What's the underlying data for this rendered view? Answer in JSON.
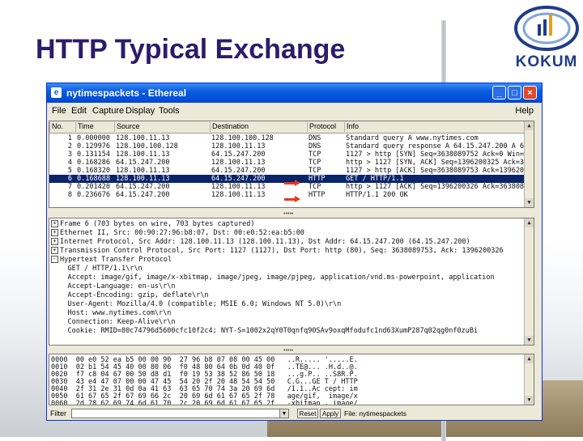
{
  "slide": {
    "title": "HTTP Typical Exchange",
    "logo_text": "KOKUM"
  },
  "window": {
    "title": "nytimespackets - Ethereal",
    "controls": {
      "minimize": "_",
      "maximize": "□",
      "close": "×"
    }
  },
  "menu": {
    "items": [
      "File",
      "Edit",
      "Capture",
      "Display",
      "Tools"
    ],
    "help": "Help"
  },
  "packet_list": {
    "columns": [
      "No.",
      "Time",
      "Source",
      "Destination",
      "Protocol",
      "Info"
    ],
    "rows": [
      {
        "no": "1",
        "time": "0.000000",
        "src": "128.100.11.13",
        "dst": "128.100.100.128",
        "proto": "DNS",
        "info": "Standard query A www.nytimes.com"
      },
      {
        "no": "2",
        "time": "0.129976",
        "src": "128.100.100.128",
        "dst": "128.100.11.13",
        "proto": "DNS",
        "info": "Standard query response A 64.15.247.200 A 64"
      },
      {
        "no": "3",
        "time": "0.131154",
        "src": "128.100.11.13",
        "dst": "64.15.247.200",
        "proto": "TCP",
        "info": "1127 > http [SYN] Seq=3638089752 Ack=0 Win=1"
      },
      {
        "no": "4",
        "time": "0.168286",
        "src": "64.15.247.200",
        "dst": "128.100.11.13",
        "proto": "TCP",
        "info": "http > 1127 [SYN, ACK] Seq=1396200325 Ack=36"
      },
      {
        "no": "5",
        "time": "0.168320",
        "src": "128.100.11.13",
        "dst": "64.15.247.200",
        "proto": "TCP",
        "info": "1127 > http [ACK] Seq=3638089753 Ack=1396200"
      },
      {
        "no": "6",
        "time": "0.168688",
        "src": "128.100.11.13",
        "dst": "64.15.247.200",
        "proto": "HTTP",
        "info": "GET / HTTP/1.1"
      },
      {
        "no": "7",
        "time": "0.201420",
        "src": "64.15.247.200",
        "dst": "128.100.11.13",
        "proto": "TCP",
        "info": "http > 1127 [ACK] Seq=1396200326 Ack=3638089"
      },
      {
        "no": "8",
        "time": "0.236676",
        "src": "64.15.247.200",
        "dst": "128.100.11.13",
        "proto": "HTTP",
        "info": "HTTP/1.1 200 OK"
      }
    ],
    "selected_index": 5
  },
  "details": {
    "lines": [
      {
        "box": "+",
        "text": "Frame 6 (703 bytes on wire, 703 bytes captured)"
      },
      {
        "box": "+",
        "text": "Ethernet II, Src: 00:90:27:96:b8:07, Dst: 00:e0:52:ea:b5:00"
      },
      {
        "box": "+",
        "text": "Internet Protocol, Src Addr: 128.100.11.13 (128.100.11.13), Dst Addr: 64.15.247.200 (64.15.247.200)"
      },
      {
        "box": "+",
        "text": "Transmission Control Protocol, Src Port: 1127 (1127), Dst Port: http (80), Seq: 3638089753, Ack: 1396200326"
      },
      {
        "box": "-",
        "text": "Hypertext Transfer Protocol"
      },
      {
        "box": "",
        "text": "    GET / HTTP/1.1\\r\\n"
      },
      {
        "box": "",
        "text": "    Accept: image/gif, image/x-xbitmap, image/jpeg, image/pjpeg, application/vnd.ms-powerpoint, application"
      },
      {
        "box": "",
        "text": "    Accept-Language: en-us\\r\\n"
      },
      {
        "box": "",
        "text": "    Accept-Encoding: gzip, deflate\\r\\n"
      },
      {
        "box": "",
        "text": "    User-Agent: Mozilla/4.0 (compatible; MSIE 6.0; Windows NT 5.0)\\r\\n"
      },
      {
        "box": "",
        "text": "    Host: www.nytimes.com\\r\\n"
      },
      {
        "box": "",
        "text": "    Connection: Keep-Alive\\r\\n"
      },
      {
        "box": "",
        "text": "    Cookie: RMID=80c74796d5600cfc10f2c4; NYT-S=1002x2qY0T0qnfq90SAv9oxqMfodufc1nd63XumP287q02qg0nf0zuBi"
      }
    ]
  },
  "bytes": {
    "lines": [
      "0000  00 e0 52 ea b5 00 00 90  27 96 b8 07 08 00 45 00   ..R..... '.....E.",
      "0010  02 b1 54 45 40 00 80 06  f0 48 80 64 0b 0d 40 0f   ..TE@... .H.d..@.",
      "0020  f7 c8 04 67 00 50 d8 d1  f0 19 53 38 52 86 50 18   ...g.P.. ..S8R.P.",
      "0030  43 e4 47 07 00 00 47 45  54 20 2f 20 48 54 54 50   C.G...GE T / HTTP",
      "0040  2f 31 2e 31 0d 0a 41 63  63 65 70 74 3a 20 69 6d   /1.1..Ac cept: im",
      "0050  61 67 65 2f 67 69 66 2c  20 69 6d 61 67 65 2f 78   age/gif,  image/x",
      "0060  2d 78 62 69 74 6d 61 70  2c 20 69 6d 61 67 65 2f   -xbitmap , image/"
    ]
  },
  "filterbar": {
    "label": "Filter",
    "value": "",
    "reset": "Reset",
    "apply": "Apply",
    "file": "File: nytimespackets"
  },
  "colors": {
    "title": "#2b1c6b",
    "titlebar": "#0a5ee0",
    "selection": "#0a246a",
    "arrow": "#e23b1c"
  }
}
